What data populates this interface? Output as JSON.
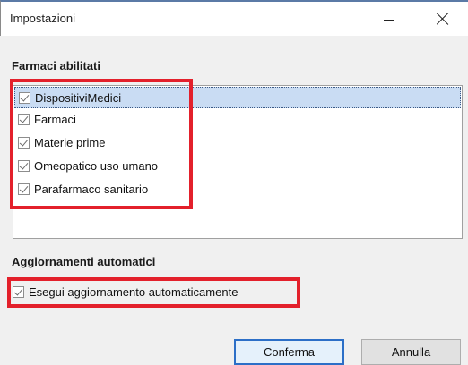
{
  "window": {
    "title": "Impostazioni"
  },
  "sections": {
    "enabled_title": "Farmaci abilitati",
    "auto_title": "Aggiornamenti automatici"
  },
  "list": {
    "items": [
      {
        "label": "DispositiviMedici",
        "checked": true,
        "selected": true
      },
      {
        "label": "Farmaci",
        "checked": true,
        "selected": false
      },
      {
        "label": "Materie prime",
        "checked": true,
        "selected": false
      },
      {
        "label": "Omeopatico uso umano",
        "checked": true,
        "selected": false
      },
      {
        "label": "Parafarmaco sanitario",
        "checked": true,
        "selected": false
      }
    ]
  },
  "auto_update": {
    "label": "Esegui aggiornamento automaticamente",
    "checked": true
  },
  "buttons": {
    "confirm": "Conferma",
    "cancel": "Annulla"
  },
  "colors": {
    "highlight_box": "#e3202b",
    "selection": "#c9dcf3",
    "accent": "#2c6fc7"
  }
}
